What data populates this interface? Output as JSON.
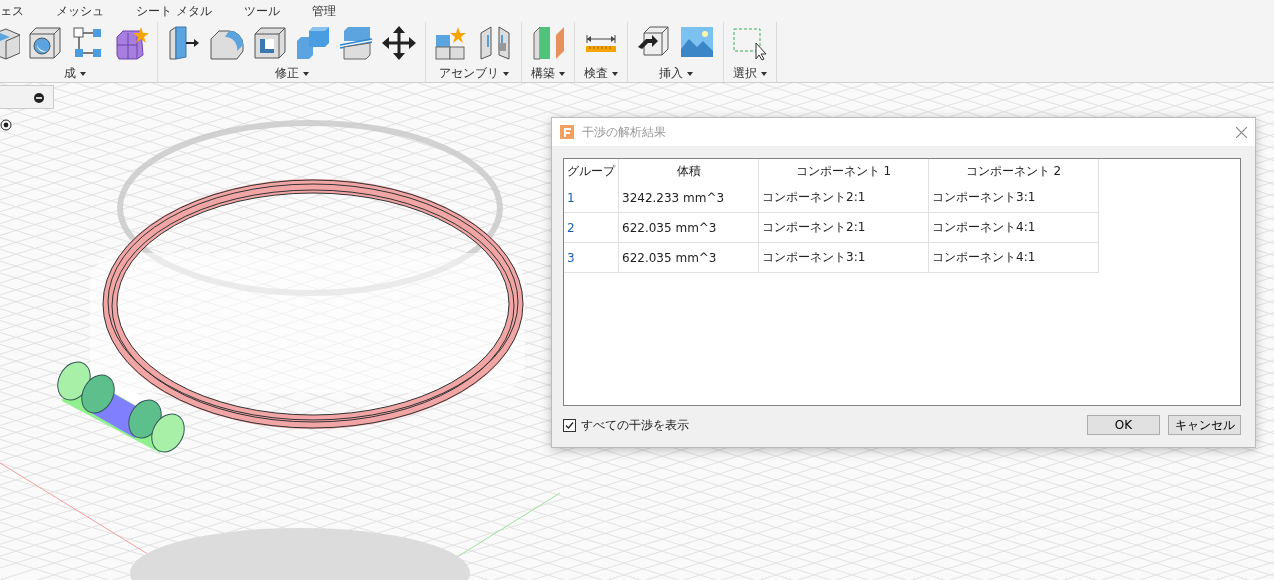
{
  "ribbon": {
    "tabs": [
      {
        "label": "ェス",
        "selected": false
      },
      {
        "label": "メッシュ",
        "selected": false
      },
      {
        "label": "シート メタル",
        "selected": false
      },
      {
        "label": "ツール",
        "selected": false
      },
      {
        "label": "管理",
        "selected": false
      }
    ],
    "groups": [
      {
        "label": "成"
      },
      {
        "label": "修正"
      },
      {
        "label": "アセンブリ"
      },
      {
        "label": "構築"
      },
      {
        "label": "検査"
      },
      {
        "label": "挿入"
      },
      {
        "label": "選択"
      }
    ]
  },
  "dialog": {
    "title": "干渉の解析結果",
    "table": {
      "columns": [
        "グループ",
        "体積",
        "コンポーネント 1",
        "コンポーネント 2"
      ],
      "rows": [
        [
          "1",
          "3242.233 mm^3",
          "コンポーネント2:1",
          "コンポーネント3:1"
        ],
        [
          "2",
          "622.035 mm^3",
          "コンポーネント2:1",
          "コンポーネント4:1"
        ],
        [
          "3",
          "622.035 mm^3",
          "コンポーネント3:1",
          "コンポーネント4:1"
        ]
      ]
    },
    "show_all": {
      "label": "すべての干渉を表示",
      "checked": true
    },
    "buttons": [
      "OK",
      "キャンセル"
    ]
  }
}
